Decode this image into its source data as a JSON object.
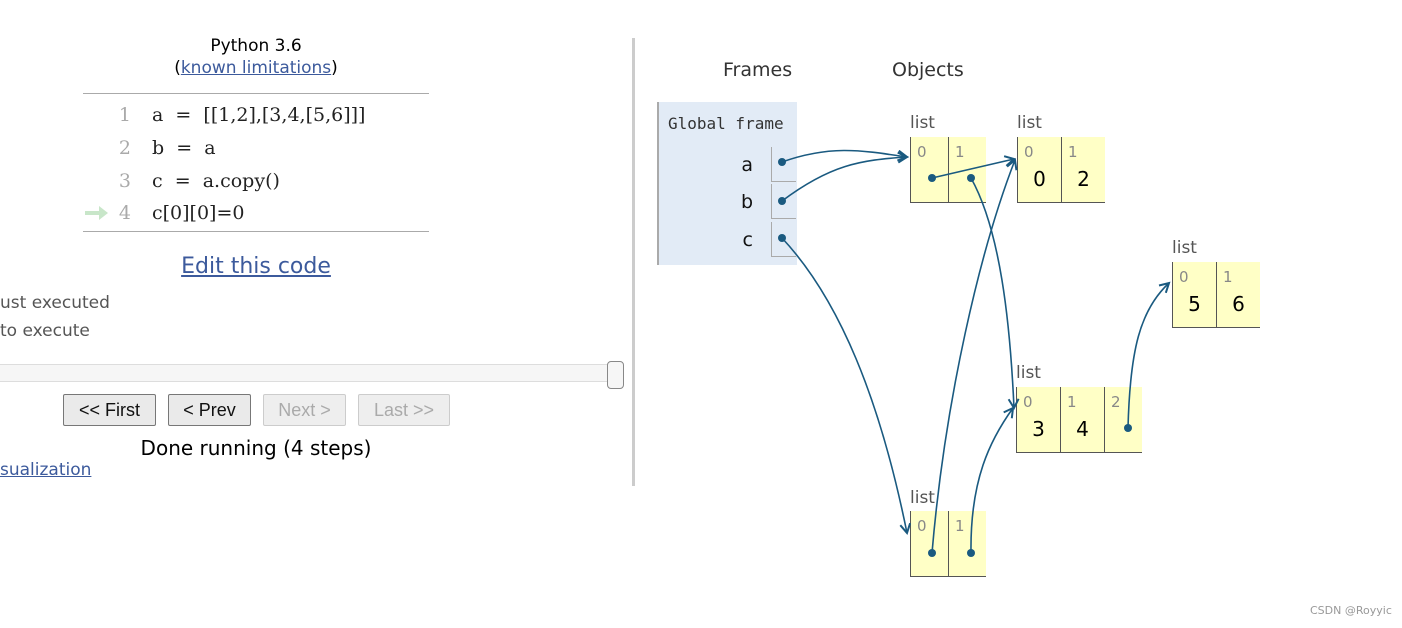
{
  "header": {
    "title": "Python 3.6",
    "limitations_open": "(",
    "limitations_link": "known limitations",
    "limitations_close": ")"
  },
  "code": {
    "lines": [
      {
        "num": "1",
        "text": "a  =  [[1,2],[3,4,[5,6]]]"
      },
      {
        "num": "2",
        "text": "b  =  a"
      },
      {
        "num": "3",
        "text": "c  =  a.copy()"
      },
      {
        "num": "4",
        "text": "c[0][0]=0",
        "current": true
      }
    ],
    "current_arrow_color": "#c8e6c9"
  },
  "edit_link": "Edit this code",
  "legend": {
    "just_executed": "ust executed",
    "to_execute": "to execute"
  },
  "slider": {
    "value": 1.0
  },
  "nav": {
    "first": "<< First",
    "prev": "< Prev",
    "next": "Next >",
    "last": "Last >>"
  },
  "status": "Done running (4 steps)",
  "visualization_link": "sualization",
  "viz": {
    "frames_header": "Frames",
    "objects_header": "Objects",
    "global_frame": "Global frame",
    "vars": [
      "a",
      "b",
      "c"
    ],
    "list_label": "list",
    "list_top_a": {
      "indices": [
        "0",
        "1"
      ]
    },
    "list_12": {
      "indices": [
        "0",
        "1"
      ],
      "values": [
        "0",
        "2"
      ]
    },
    "list_56": {
      "indices": [
        "0",
        "1"
      ],
      "values": [
        "5",
        "6"
      ]
    },
    "list_34": {
      "indices": [
        "0",
        "1",
        "2"
      ],
      "values": [
        "3",
        "4"
      ]
    },
    "list_top_c": {
      "indices": [
        "0",
        "1"
      ]
    },
    "arrow_color": "#1a5a80"
  },
  "watermark": "CSDN @Royyic"
}
